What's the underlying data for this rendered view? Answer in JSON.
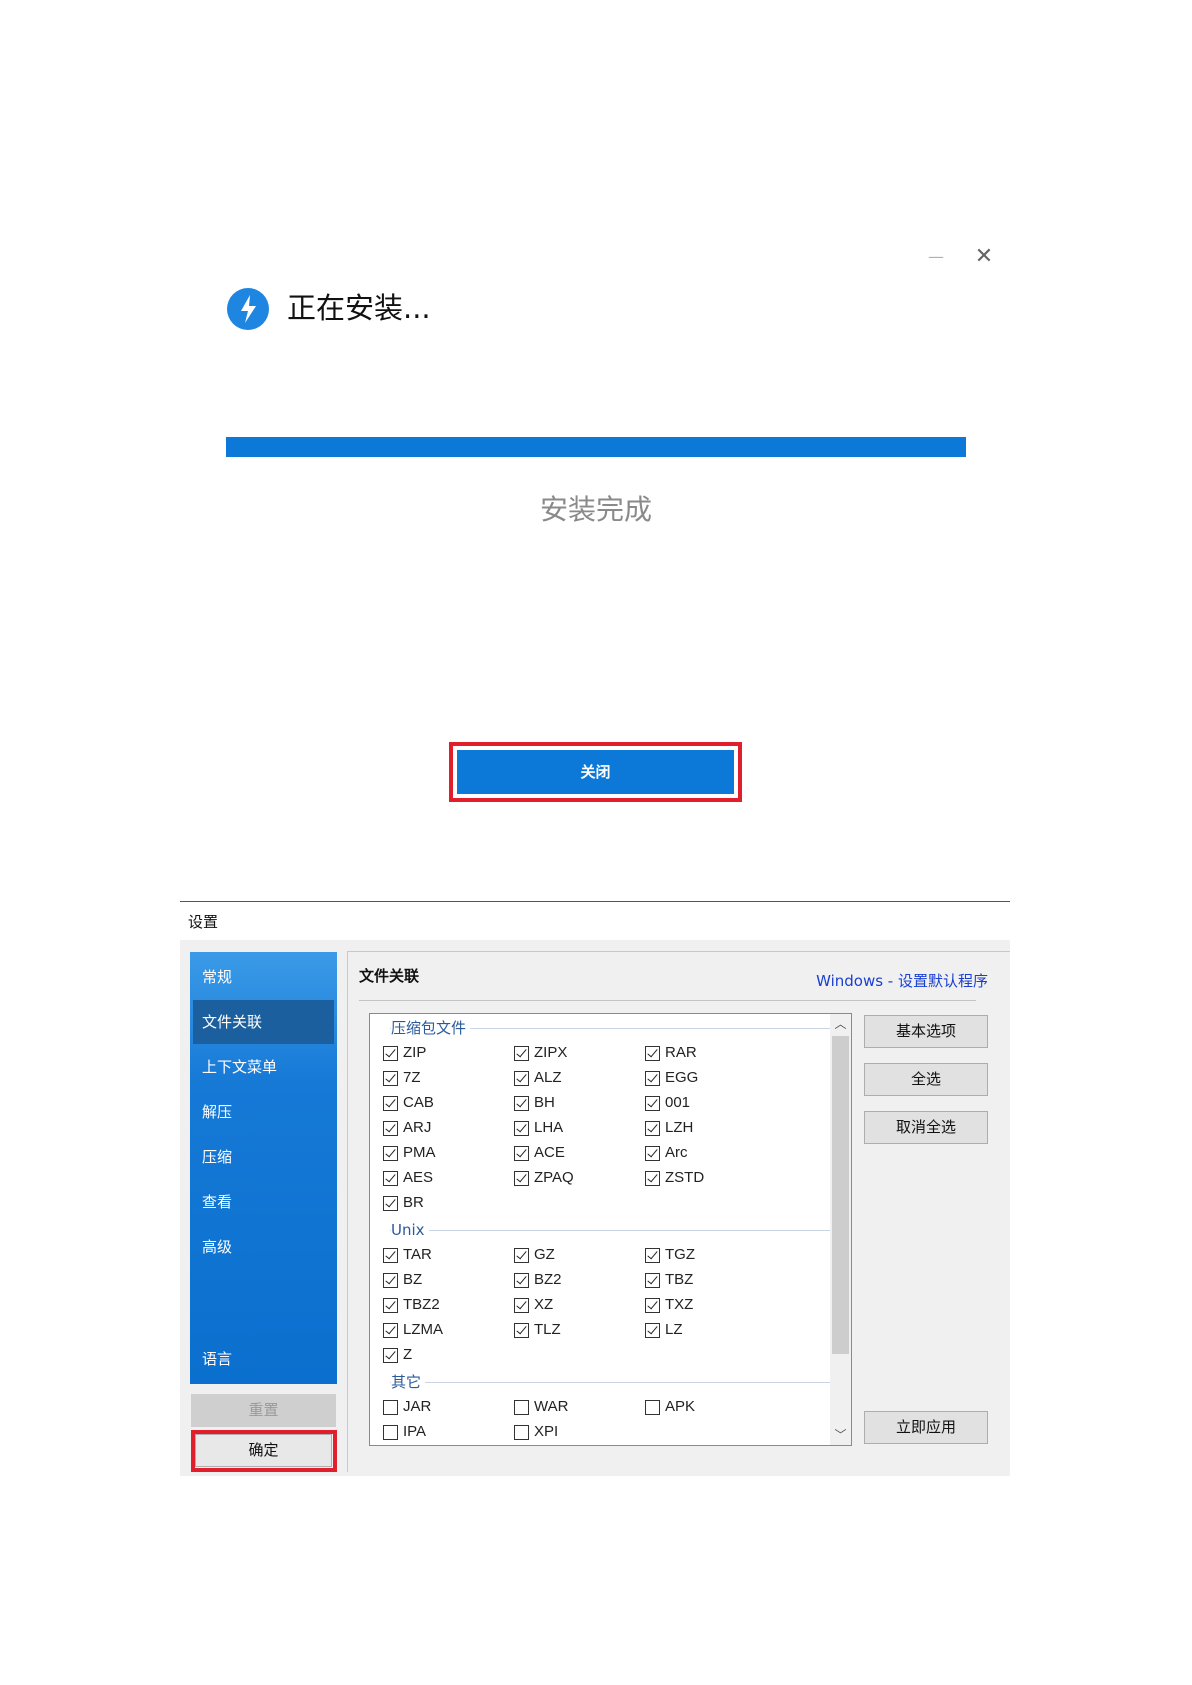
{
  "installer": {
    "title": "正在安装...",
    "status": "安装完成",
    "progress": 1.0,
    "close_button": "关闭",
    "minimize_glyph": "—",
    "close_glyph": "✕",
    "accent": "#0c78d8",
    "highlight_color": "#e01e2c"
  },
  "settings": {
    "title": "设置",
    "sidebar": [
      {
        "label": "常规",
        "active": false
      },
      {
        "label": "文件关联",
        "active": true
      },
      {
        "label": "上下文菜单",
        "active": false
      },
      {
        "label": "解压",
        "active": false
      },
      {
        "label": "压缩",
        "active": false
      },
      {
        "label": "查看",
        "active": false
      },
      {
        "label": "高级",
        "active": false
      },
      {
        "label": "语言",
        "active": false
      }
    ],
    "reset_button": "重置",
    "ok_button": "确定",
    "section_title": "文件关联",
    "windows_link": "Windows - 设置默认程序",
    "groups": [
      {
        "label": "压缩包文件",
        "items": [
          {
            "label": "ZIP",
            "checked": true
          },
          {
            "label": "ZIPX",
            "checked": true
          },
          {
            "label": "RAR",
            "checked": true
          },
          {
            "label": "7Z",
            "checked": true
          },
          {
            "label": "ALZ",
            "checked": true
          },
          {
            "label": "EGG",
            "checked": true
          },
          {
            "label": "CAB",
            "checked": true
          },
          {
            "label": "BH",
            "checked": true
          },
          {
            "label": "001",
            "checked": true
          },
          {
            "label": "ARJ",
            "checked": true
          },
          {
            "label": "LHA",
            "checked": true
          },
          {
            "label": "LZH",
            "checked": true
          },
          {
            "label": "PMA",
            "checked": true
          },
          {
            "label": "ACE",
            "checked": true
          },
          {
            "label": "Arc",
            "checked": true
          },
          {
            "label": "AES",
            "checked": true
          },
          {
            "label": "ZPAQ",
            "checked": true
          },
          {
            "label": "ZSTD",
            "checked": true
          },
          {
            "label": "BR",
            "checked": true
          }
        ]
      },
      {
        "label": "Unix",
        "items": [
          {
            "label": "TAR",
            "checked": true
          },
          {
            "label": "GZ",
            "checked": true
          },
          {
            "label": "TGZ",
            "checked": true
          },
          {
            "label": "BZ",
            "checked": true
          },
          {
            "label": "BZ2",
            "checked": true
          },
          {
            "label": "TBZ",
            "checked": true
          },
          {
            "label": "TBZ2",
            "checked": true
          },
          {
            "label": "XZ",
            "checked": true
          },
          {
            "label": "TXZ",
            "checked": true
          },
          {
            "label": "LZMA",
            "checked": true
          },
          {
            "label": "TLZ",
            "checked": true
          },
          {
            "label": "LZ",
            "checked": true
          },
          {
            "label": "Z",
            "checked": true
          }
        ]
      },
      {
        "label": "其它",
        "items": [
          {
            "label": "JAR",
            "checked": false
          },
          {
            "label": "WAR",
            "checked": false
          },
          {
            "label": "APK",
            "checked": false
          },
          {
            "label": "IPA",
            "checked": false
          },
          {
            "label": "XPI",
            "checked": false
          }
        ]
      }
    ],
    "side_buttons": [
      "基本选项",
      "全选",
      "取消全选"
    ],
    "apply_button": "立即应用",
    "scroll_up_glyph": "︿",
    "scroll_down_glyph": "﹀"
  }
}
